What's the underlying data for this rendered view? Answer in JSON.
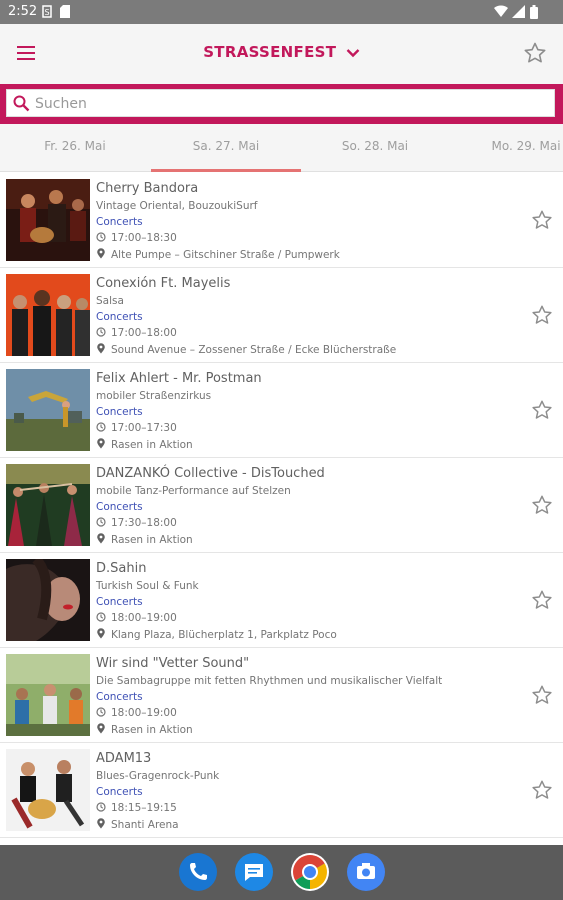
{
  "status": {
    "time": "2:52"
  },
  "appbar": {
    "title": "STRASSENFEST"
  },
  "search": {
    "placeholder": "Suchen"
  },
  "tabs": [
    "Fr. 26. Mai",
    "Sa. 27. Mai",
    "So. 28. Mai",
    "Mo. 29. Mai"
  ],
  "events": [
    {
      "title": "Cherry Bandora",
      "subtitle": "Vintage Oriental, BouzoukiSurf",
      "category": "Concerts",
      "time": "17:00–18:30",
      "location": "Alte Pumpe – Gitschiner Straße / Pumpwerk"
    },
    {
      "title": "Conexión Ft. Mayelis",
      "subtitle": "Salsa",
      "category": "Concerts",
      "time": "17:00–18:00",
      "location": "Sound Avenue – Zossener Straße / Ecke Blücherstraße"
    },
    {
      "title": "Felix Ahlert - Mr. Postman",
      "subtitle": "mobiler Straßenzirkus",
      "category": "Concerts",
      "time": "17:00–17:30",
      "location": "Rasen in Aktion"
    },
    {
      "title": "DANZANKÓ Collective - DisTouched",
      "subtitle": "mobile Tanz-Performance auf Stelzen",
      "category": "Concerts",
      "time": "17:30–18:00",
      "location": "Rasen in Aktion"
    },
    {
      "title": "D.Sahin",
      "subtitle": "Turkish Soul & Funk",
      "category": "Concerts",
      "time": "18:00–19:00",
      "location": "Klang Plaza, Blücherplatz 1, Parkplatz Poco"
    },
    {
      "title": "Wir sind \"Vetter Sound\"",
      "subtitle": "Die Sambagruppe mit fetten Rhythmen und musikalischer Vielfalt",
      "category": "Concerts",
      "time": "18:00–19:00",
      "location": "Rasen in Aktion"
    },
    {
      "title": "ADAM13",
      "subtitle": "Blues-Gragenrock-Punk",
      "category": "Concerts",
      "time": "18:15–19:15",
      "location": "Shanti Arena"
    }
  ]
}
